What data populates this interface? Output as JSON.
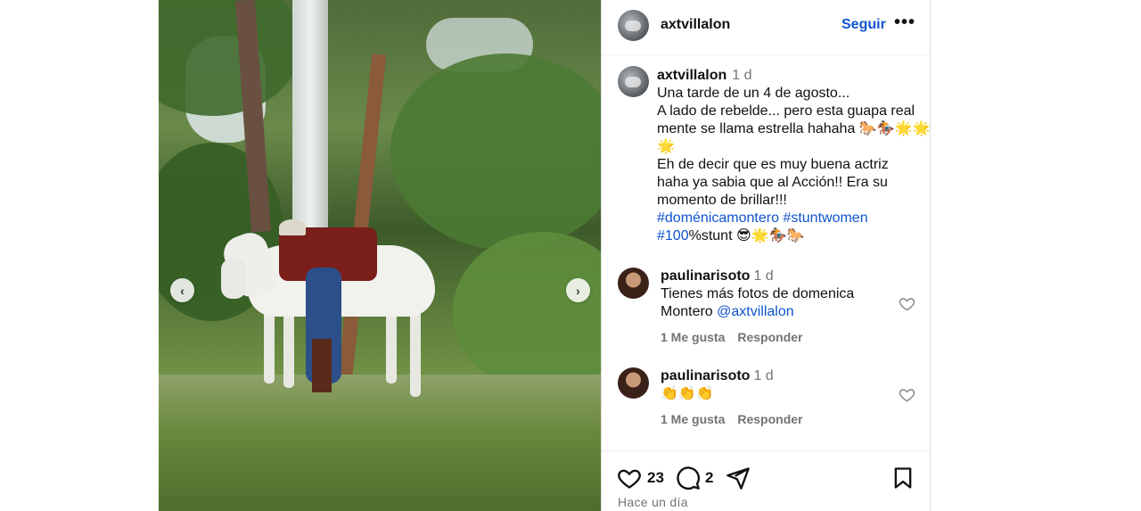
{
  "post": {
    "author": "axtvillalon",
    "follow_label": "Seguir",
    "more_label": "•••"
  },
  "caption": {
    "author": "axtvillalon",
    "time": "1 d",
    "lines": [
      "Una tarde de un 4 de agosto...",
      "A lado de rebelde... pero esta guapa real",
      "mente se llama estrella hahaha 🐎🏇🌟🌟",
      "🌟",
      "Eh de decir que es muy buena actriz",
      "haha ya sabia que al Acción!! Era su",
      "momento de brillar!!!"
    ],
    "hashtag1": "#doménicamontero",
    "hashtag2": "#stuntwomen",
    "hashtag3": "#100",
    "tail": "%stunt 😎🌟🏇🐎"
  },
  "comments": [
    {
      "user": "paulinarisoto",
      "time": "1 d",
      "text": "Tienes más fotos de domenica Montero",
      "mention": "@axtvillalon",
      "likes_label": "1 Me gusta",
      "reply_label": "Responder"
    },
    {
      "user": "paulinarisoto",
      "time": "1 d",
      "text": "👏👏👏",
      "likes_label": "1 Me gusta",
      "reply_label": "Responder"
    }
  ],
  "footer": {
    "likes": "23",
    "comments": "2",
    "time_ago": "Hace un día"
  },
  "media": {
    "prev_glyph": "‹",
    "next_glyph": "›"
  }
}
